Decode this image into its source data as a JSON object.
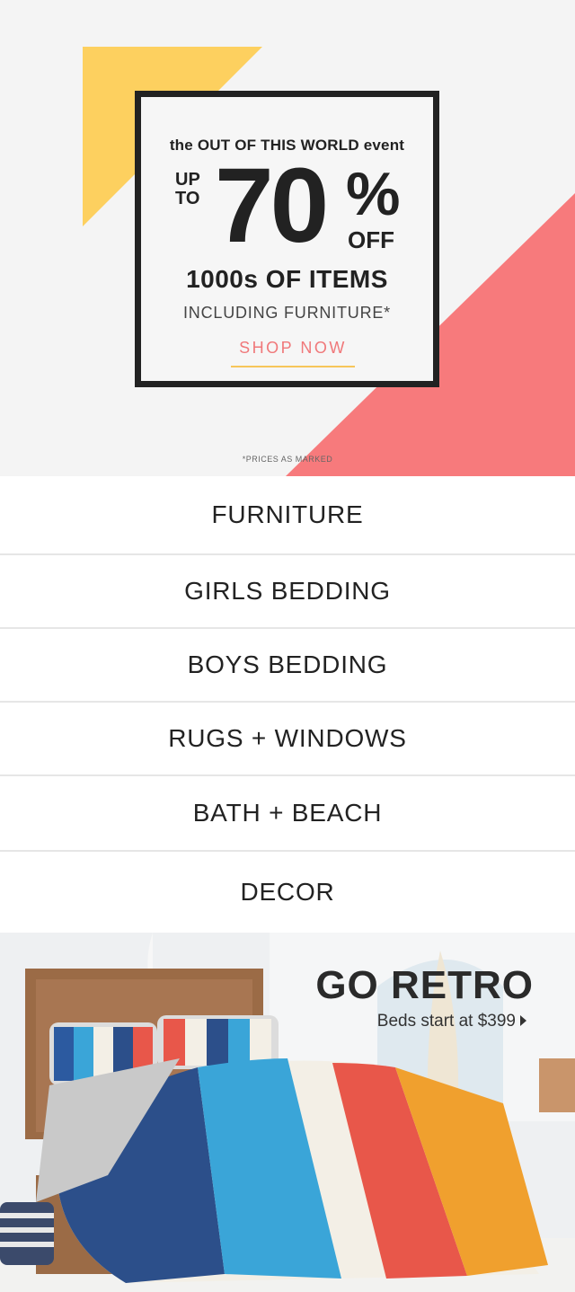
{
  "promo": {
    "kicker": "the OUT OF THIS WORLD event",
    "up_to": "UP TO",
    "percent": "70",
    "percent_sign": "%",
    "off": "OFF",
    "items": "1000s OF ITEMS",
    "including": "INCLUDING FURNITURE*",
    "cta": "SHOP NOW",
    "note": "*PRICES AS MARKED"
  },
  "colors": {
    "yellow": "#fdd05f",
    "coral": "#f77a7c",
    "cta_text": "#f0787a",
    "cta_underline": "#f7c65a"
  },
  "categories": [
    {
      "label": "FURNITURE"
    },
    {
      "label": "GIRLS BEDDING"
    },
    {
      "label": "BOYS BEDDING"
    },
    {
      "label": "RUGS + WINDOWS"
    },
    {
      "label": "BATH + BEACH"
    },
    {
      "label": "DECOR"
    }
  ],
  "retro": {
    "title": "GO RETRO",
    "subtitle": "Beds start at $399"
  }
}
